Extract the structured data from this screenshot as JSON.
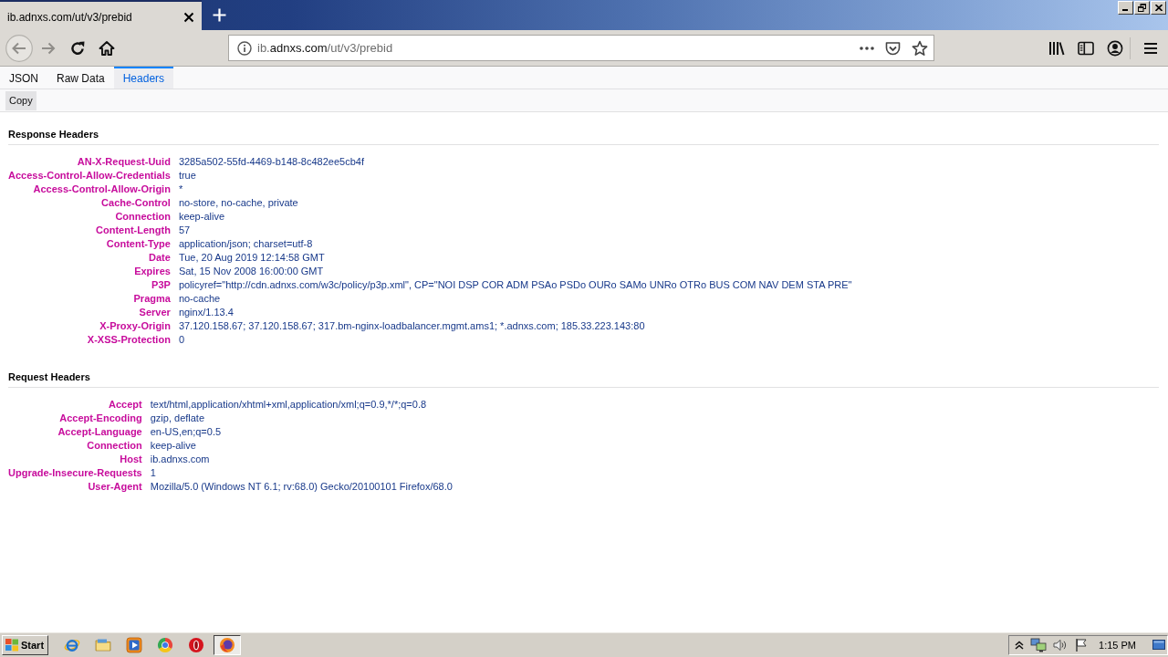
{
  "browser_tabs": [
    {
      "title": "ib.adnxs.com/ut/v3/prebid",
      "selected": true
    }
  ],
  "nav_buttons": [
    {
      "kind": "back",
      "disabled": true
    },
    {
      "kind": "forward",
      "disabled": true
    },
    {
      "kind": "reload",
      "disabled": false
    },
    {
      "kind": "home",
      "disabled": false
    }
  ],
  "address_bar": {
    "url_prefix": "ib.",
    "url_domain": "adnxs.com",
    "url_path": "/ut/v3/prebid"
  },
  "viewer_tabs": [
    {
      "label": "JSON",
      "selected": false
    },
    {
      "label": "Raw Data",
      "selected": false
    },
    {
      "label": "Headers",
      "selected": true
    }
  ],
  "toolbar": {
    "buttons": [
      "Copy"
    ]
  },
  "sections": [
    {
      "title": "Response Headers",
      "headers": [
        {
          "name": "AN-X-Request-Uuid",
          "value": "3285a502-55fd-4469-b148-8c482ee5cb4f"
        },
        {
          "name": "Access-Control-Allow-Credentials",
          "value": "true"
        },
        {
          "name": "Access-Control-Allow-Origin",
          "value": "*"
        },
        {
          "name": "Cache-Control",
          "value": "no-store, no-cache, private"
        },
        {
          "name": "Connection",
          "value": "keep-alive"
        },
        {
          "name": "Content-Length",
          "value": "57"
        },
        {
          "name": "Content-Type",
          "value": "application/json; charset=utf-8"
        },
        {
          "name": "Date",
          "value": "Tue, 20 Aug 2019 12:14:58 GMT"
        },
        {
          "name": "Expires",
          "value": "Sat, 15 Nov 2008 16:00:00 GMT"
        },
        {
          "name": "P3P",
          "value": "policyref=\"http://cdn.adnxs.com/w3c/policy/p3p.xml\", CP=\"NOI DSP COR ADM PSAo PSDo OURo SAMo UNRo OTRo BUS COM NAV DEM STA PRE\""
        },
        {
          "name": "Pragma",
          "value": "no-cache"
        },
        {
          "name": "Server",
          "value": "nginx/1.13.4"
        },
        {
          "name": "X-Proxy-Origin",
          "value": "37.120.158.67; 37.120.158.67; 317.bm-nginx-loadbalancer.mgmt.ams1; *.adnxs.com; 185.33.223.143:80"
        },
        {
          "name": "X-XSS-Protection",
          "value": "0"
        }
      ]
    },
    {
      "title": "Request Headers",
      "headers": [
        {
          "name": "Accept",
          "value": "text/html,application/xhtml+xml,application/xml;q=0.9,*/*;q=0.8"
        },
        {
          "name": "Accept-Encoding",
          "value": "gzip, deflate"
        },
        {
          "name": "Accept-Language",
          "value": "en-US,en;q=0.5"
        },
        {
          "name": "Connection",
          "value": "keep-alive"
        },
        {
          "name": "Host",
          "value": "ib.adnxs.com"
        },
        {
          "name": "Upgrade-Insecure-Requests",
          "value": "1"
        },
        {
          "name": "User-Agent",
          "value": "Mozilla/5.0 (Windows NT 6.1; rv:68.0) Gecko/20100101 Firefox/68.0"
        }
      ]
    }
  ],
  "taskbar": {
    "start": "Start",
    "apps": [
      {
        "kind": "e-globe",
        "selected": false
      },
      {
        "kind": "folder",
        "selected": false
      },
      {
        "kind": "play",
        "selected": false
      },
      {
        "kind": "ring",
        "selected": false
      },
      {
        "kind": "o-ring",
        "selected": false
      },
      {
        "kind": "fox-globe",
        "selected": true
      }
    ],
    "clock": "1:15 PM"
  }
}
